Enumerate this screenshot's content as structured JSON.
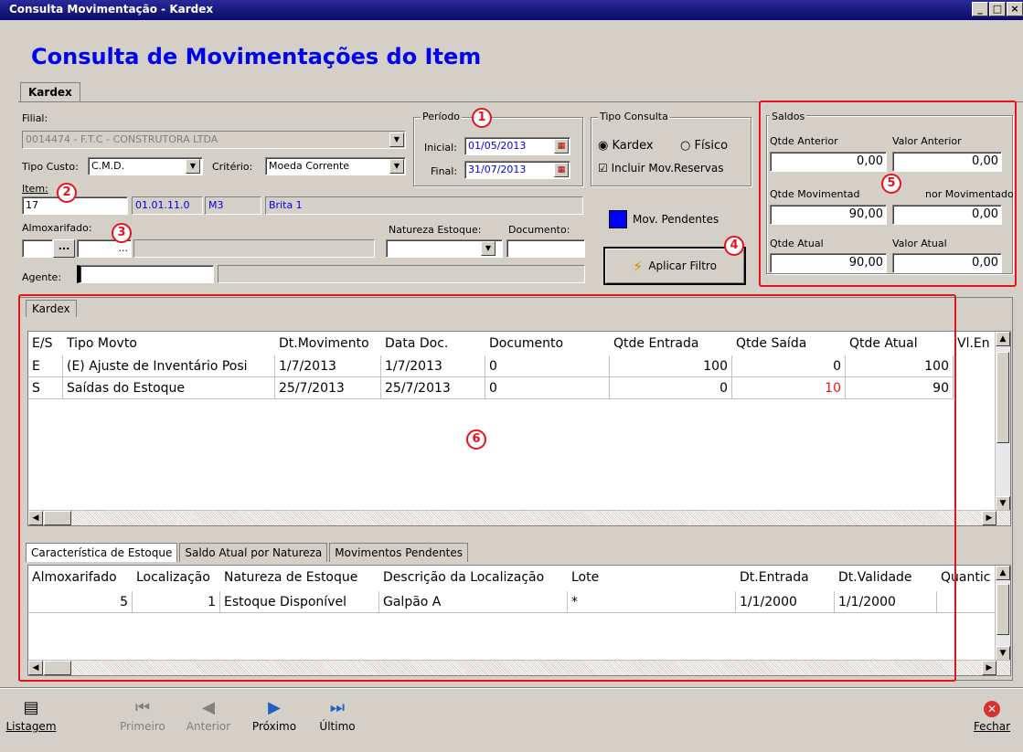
{
  "window": {
    "title": "Consulta Movimentação - Kardex",
    "min": "_",
    "max": "□",
    "close": "×"
  },
  "page_title": "Consulta de Movimentações do Item",
  "top_tab": "Kardex",
  "filial": {
    "label": "Filial:",
    "value": "0014474 - F.T.C - CONSTRUTORA LTDA"
  },
  "tipo_custo": {
    "label": "Tipo Custo:",
    "value": "C.M.D."
  },
  "criterio": {
    "label": "Critério:",
    "value": "Moeda Corrente"
  },
  "item": {
    "label": "Item:",
    "code": "17",
    "class": "01.01.11.0",
    "unit": "M3",
    "name": "Brita 1"
  },
  "almoxarifado": {
    "label": "Almoxarifado:",
    "btn": "...",
    "btn2": "..."
  },
  "natureza": {
    "label": "Natureza Estoque:"
  },
  "documento": {
    "label": "Documento:"
  },
  "agente": {
    "label": "Agente:"
  },
  "periodo": {
    "title": "Período",
    "inicial_label": "Inicial:",
    "inicial": "01/05/2013",
    "final_label": "Final:",
    "final": "31/07/2013",
    "cal_icon": "calendar-icon"
  },
  "tipo_consulta": {
    "title": "Tipo Consulta",
    "kardex": "Kardex",
    "fisico": "Físico",
    "incluir": "Incluir Mov.Reservas"
  },
  "mov_pendentes": "Mov. Pendentes",
  "aplicar_filtro": "Aplicar Filtro",
  "saldos": {
    "title": "Saldos",
    "qtde_anterior_label": "Qtde Anterior",
    "qtde_anterior": "0,00",
    "valor_anterior_label": "Valor Anterior",
    "valor_anterior": "0,00",
    "qtde_mov_label": "Qtde Movimentad",
    "qtde_mov": "90,00",
    "valor_mov_label": "nor Movimentado",
    "valor_mov": "0,00",
    "qtde_atual_label": "Qtde Atual",
    "qtde_atual": "90,00",
    "valor_atual_label": "Valor Atual",
    "valor_atual": "0,00"
  },
  "kardex_tab": "Kardex",
  "kardex_grid": {
    "headers": [
      "E/S",
      "Tipo Movto",
      "Dt.Movimento",
      "Data Doc.",
      "Documento",
      "Qtde Entrada",
      "Qtde Saída",
      "Qtde Atual",
      "Vl.En"
    ],
    "rows": [
      [
        "E",
        "(E) Ajuste de Inventário Posi",
        "1/7/2013",
        "1/7/2013",
        "0",
        "100",
        "0",
        "100"
      ],
      [
        "S",
        "Saídas do Estoque",
        "25/7/2013",
        "25/7/2013",
        "0",
        "0",
        "10",
        "90"
      ]
    ]
  },
  "bottom_tabs": [
    "Característica de Estoque",
    "Saldo Atual por Natureza",
    "Movimentos Pendentes"
  ],
  "estoque_grid": {
    "headers": [
      "Almoxarifado",
      "Localização",
      "Natureza de Estoque",
      "Descrição da Localização",
      "Lote",
      "Dt.Entrada",
      "Dt.Validade",
      "Quantic"
    ],
    "rows": [
      [
        "5",
        "1",
        "Estoque Disponível",
        "Galpão A",
        "*",
        "1/1/2000",
        "1/1/2000",
        ""
      ]
    ]
  },
  "annotations": [
    "1",
    "2",
    "3",
    "4",
    "5",
    "6"
  ],
  "toolbar": {
    "listagem": "Listagem",
    "primeiro": "Primeiro",
    "anterior": "Anterior",
    "proximo": "Próximo",
    "ultimo": "Último",
    "fechar": "Fechar"
  },
  "colors": {
    "accent": "#0000ee",
    "annotation": "#e8121e",
    "saida": "#e8121e"
  }
}
